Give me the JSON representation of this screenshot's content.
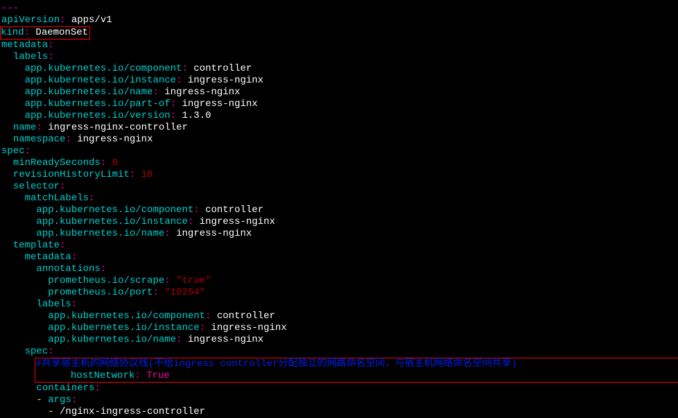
{
  "l0": "---",
  "k": {
    "apiVersion": "apiVersion",
    "kind": "kind",
    "metadata": "metadata",
    "labels": "labels",
    "component": "app.kubernetes.io/component",
    "instance": "app.kubernetes.io/instance",
    "ioname": "app.kubernetes.io/name",
    "partof": "app.kubernetes.io/part-of",
    "version": "app.kubernetes.io/version",
    "name": "name",
    "namespace": "namespace",
    "spec": "spec",
    "minReadySeconds": "minReadySeconds",
    "revisionHistoryLimit": "revisionHistoryLimit",
    "selector": "selector",
    "matchLabels": "matchLabels",
    "template": "template",
    "annotations": "annotations",
    "scrape": "prometheus.io/scrape",
    "port": "prometheus.io/port",
    "hostNetwork": "hostNetwork",
    "containers": "containers",
    "args": "args"
  },
  "v": {
    "apiVersion": "apps/v1",
    "kind": "DaemonSet",
    "controller": "controller",
    "ingressNginx": "ingress-nginx",
    "v130": "1.3.0",
    "nameCtl": "ingress-nginx-controller",
    "zero": "0",
    "ten": "10",
    "trueQ": "\"true\"",
    "portQ": "\"10254\"",
    "comment": "#共享宿主机的网络协议栈(不给ingress controller分配独立的网路命名空间，与宿主机网络命名空间共享)",
    "True": "True",
    "nginxCtrl": "/nginx-ingress-controller"
  },
  "colon": ":",
  "dash": "-",
  "sp": " "
}
